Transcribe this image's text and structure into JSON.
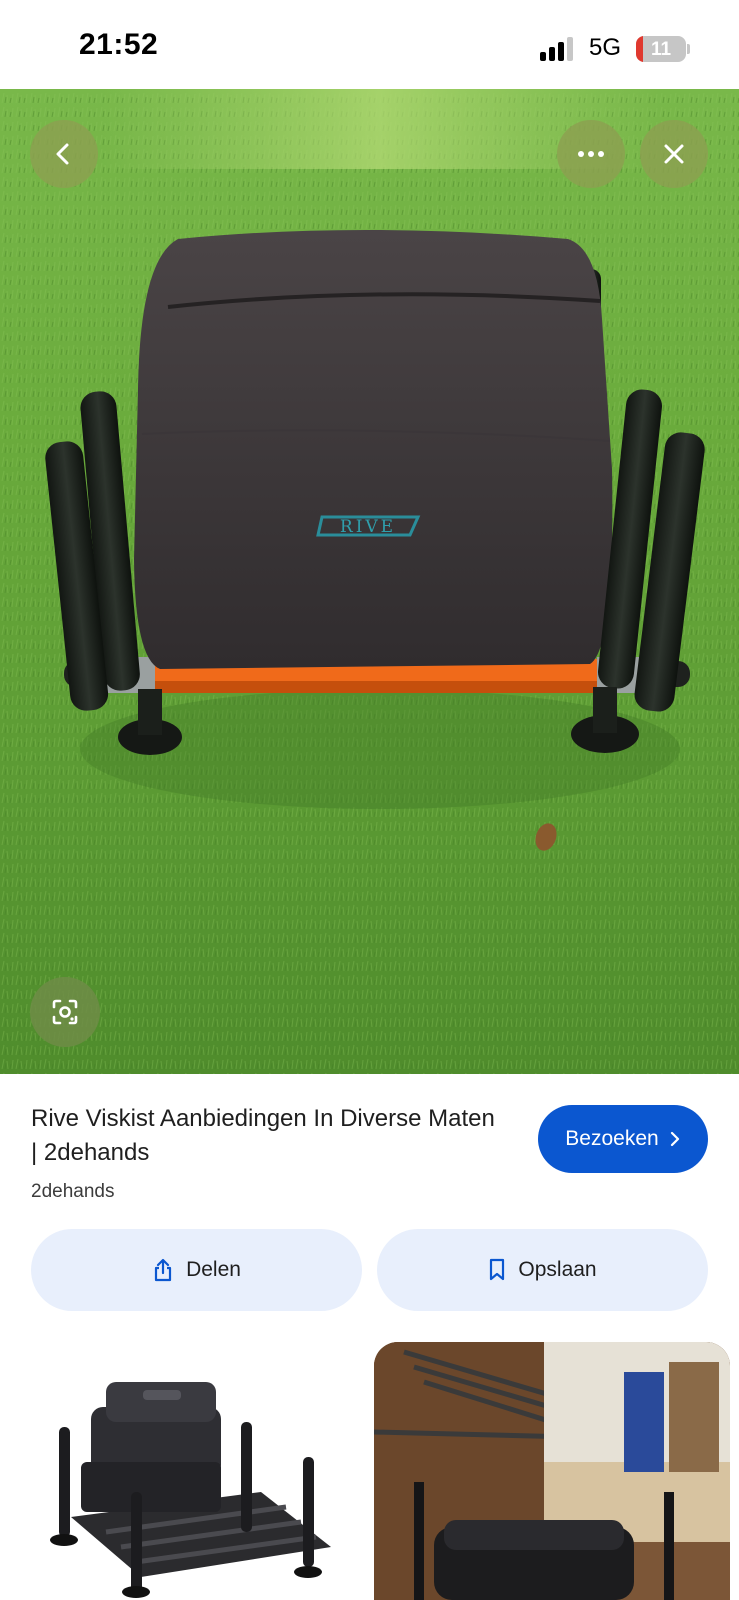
{
  "status_bar": {
    "time": "21:52",
    "network": "5G",
    "battery_level": "11",
    "icons": [
      "signal-icon",
      "battery-icon"
    ]
  },
  "viewer": {
    "controls": {
      "back": "chevron-left-icon",
      "more": "more-horizontal-icon",
      "close": "close-icon",
      "lens": "lens-search-icon"
    },
    "image_brand_text": "RIVE"
  },
  "result": {
    "title": "Rive Viskist Aanbiedingen In Diverse Maten | 2dehands",
    "source": "2dehands",
    "visit_label": "Bezoeken",
    "share_label": "Delen",
    "save_label": "Opslaan"
  },
  "colors": {
    "accent": "#0b57d0",
    "action_bg": "#e8effc",
    "battery_low": "#e0392f",
    "grass": "#5d9a34",
    "frame_orange": "#f06a1a"
  }
}
